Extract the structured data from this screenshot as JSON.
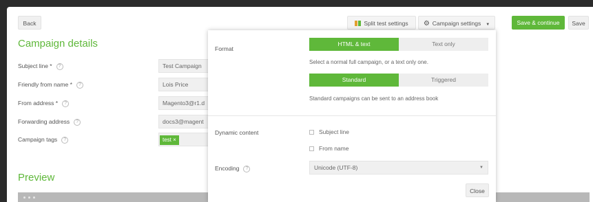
{
  "toolbar": {
    "back": "Back",
    "split_test": "Split test settings",
    "campaign_settings": "Campaign settings",
    "save_continue": "Save & continue",
    "save": "Save"
  },
  "details": {
    "title": "Campaign details",
    "fields": [
      {
        "label": "Subject line *",
        "value": "Test Campaign"
      },
      {
        "label": "Friendly from name *",
        "value": "Lois Price"
      },
      {
        "label": "From address *",
        "value": "Magento3@r1.d"
      },
      {
        "label": "Forwarding address",
        "value": "docs3@magent"
      },
      {
        "label": "Campaign tags",
        "tag": "test ×"
      }
    ]
  },
  "preview": {
    "title": "Preview"
  },
  "settings_panel": {
    "format_label": "Format",
    "format_options": [
      "HTML & text",
      "Text only"
    ],
    "format_note": "Select a normal full campaign, or a text only one.",
    "type_options": [
      "Standard",
      "Triggered"
    ],
    "type_note": "Standard campaigns can be sent to an address book",
    "dynamic_label": "Dynamic content",
    "dynamic_options": [
      "Subject line",
      "From name"
    ],
    "encoding_label": "Encoding",
    "encoding_value": "Unicode (UTF-8)",
    "close": "Close"
  },
  "colors": {
    "accent": "#5fb83a",
    "background": "#2b2b2b"
  },
  "icons": [
    "split-test-icon",
    "gear-icon",
    "caret-down-icon",
    "help-icon",
    "checkbox-icon"
  ]
}
